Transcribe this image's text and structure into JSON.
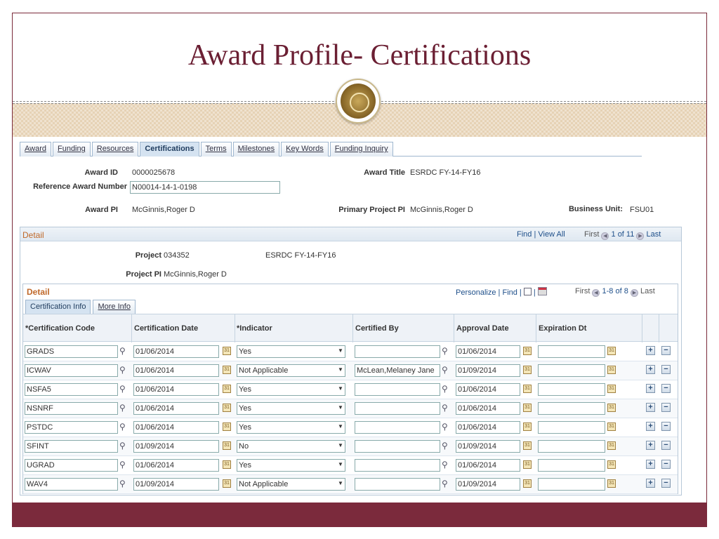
{
  "slide": {
    "title": "Award Profile- Certifications"
  },
  "tabs": [
    {
      "label": "Award"
    },
    {
      "label": "Funding"
    },
    {
      "label": "Resources"
    },
    {
      "label": "Certifications"
    },
    {
      "label": "Terms"
    },
    {
      "label": "Milestones"
    },
    {
      "label": "Key Words"
    },
    {
      "label": "Funding Inquiry"
    }
  ],
  "header": {
    "award_id_label": "Award ID",
    "award_id": "0000025678",
    "award_title_label": "Award Title",
    "award_title": "ESRDC FY-14-FY16",
    "ref_award_label": "Reference Award Number",
    "ref_award": "N00014-14-1-0198",
    "award_pi_label": "Award PI",
    "award_pi": "McGinnis,Roger D",
    "primary_pi_label": "Primary Project PI",
    "primary_pi": "McGinnis,Roger D",
    "business_unit_label": "Business Unit:",
    "business_unit": "FSU01"
  },
  "detail": {
    "title": "Detail",
    "find": "Find",
    "sep": "|",
    "view_all": "View All",
    "first": "First",
    "count": "1 of 11",
    "last": "Last",
    "project_label": "Project",
    "project": "034352",
    "project_desc": "ESRDC FY-14-FY16",
    "project_pi_label": "Project PI",
    "project_pi": "McGinnis,Roger D"
  },
  "cert": {
    "title": "Detail",
    "personalize": "Personalize",
    "find": "Find",
    "first": "First",
    "count": "1-8 of 8",
    "last": "Last",
    "subtabs": [
      {
        "label": "Certification Info"
      },
      {
        "label": "More Info"
      }
    ],
    "columns": [
      "*Certification Code",
      "Certification Date",
      "*Indicator",
      "Certified By",
      "Approval Date",
      "Expiration Dt"
    ],
    "rows": [
      {
        "code": "GRADS",
        "cert_date": "01/06/2014",
        "indicator": "Yes",
        "certified_by": "",
        "approval_date": "01/06/2014",
        "expiration": ""
      },
      {
        "code": "ICWAV",
        "cert_date": "01/06/2014",
        "indicator": "Not Applicable",
        "certified_by": "McLean,Melaney Jane",
        "approval_date": "01/09/2014",
        "expiration": ""
      },
      {
        "code": "NSFA5",
        "cert_date": "01/06/2014",
        "indicator": "Yes",
        "certified_by": "",
        "approval_date": "01/06/2014",
        "expiration": ""
      },
      {
        "code": "NSNRF",
        "cert_date": "01/06/2014",
        "indicator": "Yes",
        "certified_by": "",
        "approval_date": "01/06/2014",
        "expiration": ""
      },
      {
        "code": "PSTDC",
        "cert_date": "01/06/2014",
        "indicator": "Yes",
        "certified_by": "",
        "approval_date": "01/06/2014",
        "expiration": ""
      },
      {
        "code": "SFINT",
        "cert_date": "01/09/2014",
        "indicator": "No",
        "certified_by": "",
        "approval_date": "01/09/2014",
        "expiration": ""
      },
      {
        "code": "UGRAD",
        "cert_date": "01/06/2014",
        "indicator": "Yes",
        "certified_by": "",
        "approval_date": "01/06/2014",
        "expiration": ""
      },
      {
        "code": "WAV4",
        "cert_date": "01/09/2014",
        "indicator": "Not Applicable",
        "certified_by": "",
        "approval_date": "01/09/2014",
        "expiration": ""
      }
    ]
  },
  "colors": {
    "accent": "#7b2a3c",
    "section_title": "#c0692a",
    "link": "#1e4f8a"
  }
}
